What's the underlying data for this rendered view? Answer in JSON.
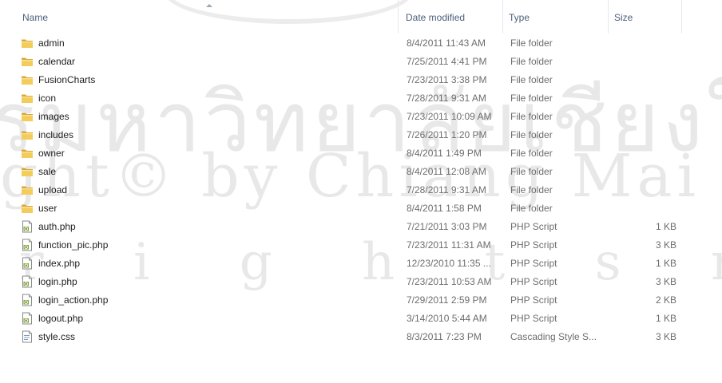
{
  "columns": {
    "name": "Name",
    "date": "Date modified",
    "type": "Type",
    "size": "Size"
  },
  "rows": [
    {
      "name": "admin",
      "date": "8/4/2011 11:43 AM",
      "type": "File folder",
      "size": "",
      "icon": "folder-icon"
    },
    {
      "name": "calendar",
      "date": "7/25/2011 4:41 PM",
      "type": "File folder",
      "size": "",
      "icon": "folder-icon"
    },
    {
      "name": "FusionCharts",
      "date": "7/23/2011 3:38 PM",
      "type": "File folder",
      "size": "",
      "icon": "folder-icon"
    },
    {
      "name": "icon",
      "date": "7/28/2011 9:31 AM",
      "type": "File folder",
      "size": "",
      "icon": "folder-icon"
    },
    {
      "name": "images",
      "date": "7/23/2011 10:09 AM",
      "type": "File folder",
      "size": "",
      "icon": "folder-icon"
    },
    {
      "name": "includes",
      "date": "7/26/2011 1:20 PM",
      "type": "File folder",
      "size": "",
      "icon": "folder-icon"
    },
    {
      "name": "owner",
      "date": "8/4/2011 1:49 PM",
      "type": "File folder",
      "size": "",
      "icon": "folder-icon"
    },
    {
      "name": "sale",
      "date": "8/4/2011 12:08 AM",
      "type": "File folder",
      "size": "",
      "icon": "folder-icon"
    },
    {
      "name": "upload",
      "date": "7/28/2011 9:31 AM",
      "type": "File folder",
      "size": "",
      "icon": "folder-icon"
    },
    {
      "name": "user",
      "date": "8/4/2011 1:58 PM",
      "type": "File folder",
      "size": "",
      "icon": "folder-icon"
    },
    {
      "name": "auth.php",
      "date": "7/21/2011 3:03 PM",
      "type": "PHP Script",
      "size": "1 KB",
      "icon": "php-file-icon"
    },
    {
      "name": "function_pic.php",
      "date": "7/23/2011 11:31 AM",
      "type": "PHP Script",
      "size": "3 KB",
      "icon": "php-file-icon"
    },
    {
      "name": "index.php",
      "date": "12/23/2010 11:35 ...",
      "type": "PHP Script",
      "size": "1 KB",
      "icon": "php-file-icon"
    },
    {
      "name": "login.php",
      "date": "7/23/2011 10:53 AM",
      "type": "PHP Script",
      "size": "3 KB",
      "icon": "php-file-icon"
    },
    {
      "name": "login_action.php",
      "date": "7/29/2011 2:59 PM",
      "type": "PHP Script",
      "size": "2 KB",
      "icon": "php-file-icon"
    },
    {
      "name": "logout.php",
      "date": "3/14/2010 5:44 AM",
      "type": "PHP Script",
      "size": "1 KB",
      "icon": "php-file-icon"
    },
    {
      "name": "style.css",
      "date": "8/3/2011 7:23 PM",
      "type": "Cascading Style S...",
      "size": "3 KB",
      "icon": "css-file-icon"
    }
  ],
  "watermark": {
    "line1": "รมหาวิทยาลัยเชียงใ",
    "line2": "ght© by Chiang Mai Univer",
    "line3": "r i g h t s r e s e r v"
  }
}
